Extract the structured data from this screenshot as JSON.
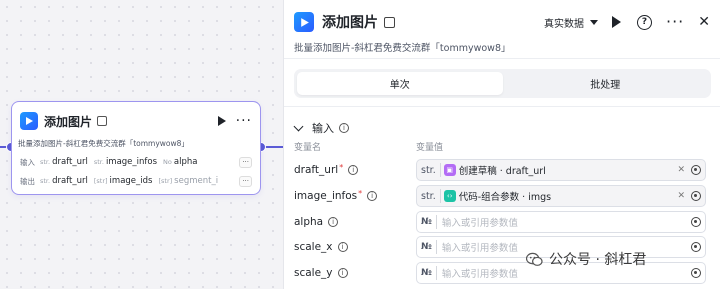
{
  "node": {
    "title": "添加图片",
    "description": "批量添加图片-斜杠君免费交流群「tommywow8」",
    "input_label": "输入",
    "output_label": "输出",
    "inputs": [
      {
        "type": "str.",
        "name": "draft_url"
      },
      {
        "type": "str.",
        "name": "image_infos"
      },
      {
        "type": "No",
        "name": "alpha"
      }
    ],
    "outputs": [
      {
        "type": "str.",
        "name": "draft_url"
      },
      {
        "type": "[str]",
        "name": "image_ids"
      },
      {
        "type": "[str]",
        "name": "segment_i"
      }
    ],
    "more_label": "···"
  },
  "panel": {
    "title": "添加图片",
    "mode_label": "真实数据",
    "description": "批量添加图片-斜杠君免费交流群「tommywow8」",
    "tabs": [
      {
        "label": "单次",
        "active": true
      },
      {
        "label": "批处理",
        "active": false
      }
    ],
    "input_section": "输入",
    "col_name": "变量名",
    "col_value": "变量值",
    "params": [
      {
        "name": "draft_url",
        "required": true,
        "type": "str.",
        "ref_icon": "draft-icon",
        "ref_label": "创建草稿 · draft_url",
        "placeholder": ""
      },
      {
        "name": "image_infos",
        "required": true,
        "type": "str.",
        "ref_icon": "code-icon",
        "ref_label": "代码-组合参数 · imgs",
        "placeholder": ""
      },
      {
        "name": "alpha",
        "required": false,
        "type": "№",
        "ref_label": "",
        "placeholder": "输入或引用参数值"
      },
      {
        "name": "scale_x",
        "required": false,
        "type": "№",
        "ref_label": "",
        "placeholder": "输入或引用参数值"
      },
      {
        "name": "scale_y",
        "required": false,
        "type": "№",
        "ref_label": "",
        "placeholder": "输入或引用参数值"
      }
    ]
  },
  "watermark": "公众号 · 斜杠君",
  "colors": {
    "accent": "#5b5bd6",
    "brand_blue": "#1e7bff",
    "draft_purple": "#b36cf5",
    "code_teal": "#1cc3a6"
  }
}
